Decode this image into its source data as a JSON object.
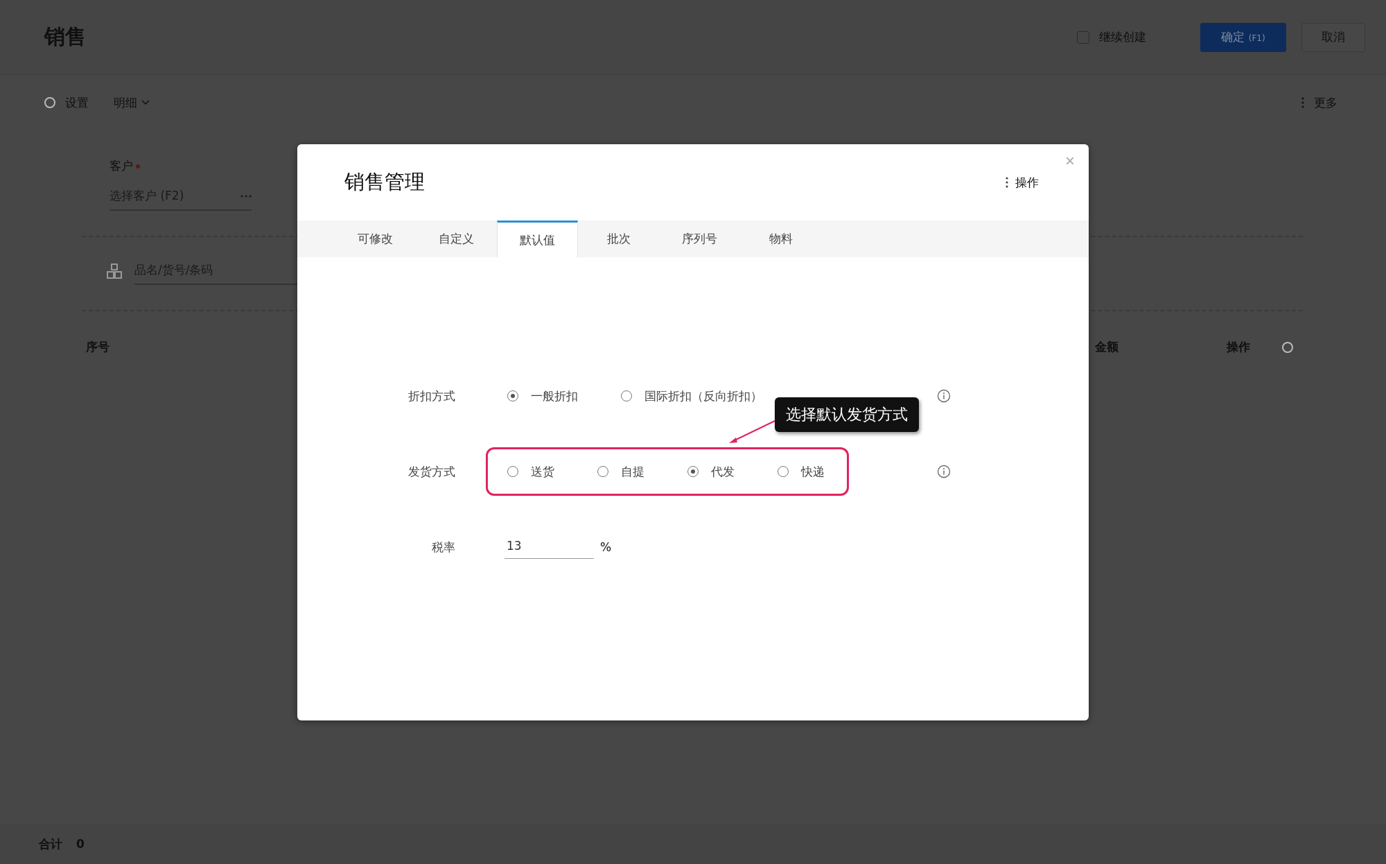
{
  "page": {
    "title": "销售",
    "continue_create": {
      "label": "继续创建",
      "checked": false
    },
    "buttons": [
      {
        "label": "确定",
        "hint": "(F1)",
        "kind": "primary"
      },
      {
        "label": "取消",
        "kind": "default"
      }
    ],
    "toolbar": {
      "settings": "设置",
      "detail": "明细",
      "more": "更多"
    },
    "customer": {
      "label": "客户",
      "required": true,
      "placeholder": "选择客户 (F2)"
    },
    "search": {
      "placeholder": "品名/货号/条码"
    },
    "table": {
      "columns": [
        "序号",
        "金额",
        "操作"
      ]
    },
    "footer": {
      "label": "合计",
      "value": "0"
    }
  },
  "dialog": {
    "title": "销售管理",
    "menu": "操作",
    "close": "×",
    "tabs": [
      {
        "label": "可修改",
        "selected": false
      },
      {
        "label": "自定义",
        "selected": false
      },
      {
        "label": "默认值",
        "selected": true
      },
      {
        "label": "批次",
        "selected": false
      },
      {
        "label": "序列号",
        "selected": false
      },
      {
        "label": "物料",
        "selected": false
      }
    ],
    "fields": [
      {
        "kind": "radio",
        "label": "折扣方式",
        "highlighted": false,
        "options": [
          {
            "label": "一般折扣",
            "selected": true
          },
          {
            "label": "国际折扣（反向折扣）",
            "selected": false
          }
        ]
      },
      {
        "kind": "radio",
        "label": "发货方式",
        "highlighted": true,
        "options": [
          {
            "label": "送货",
            "selected": false
          },
          {
            "label": "自提",
            "selected": false
          },
          {
            "label": "代发",
            "selected": true
          },
          {
            "label": "快递",
            "selected": false
          }
        ]
      },
      {
        "kind": "input",
        "label": "税率",
        "value": "13",
        "unit": "%"
      }
    ]
  },
  "annotation": {
    "text": "选择默认发货方式"
  }
}
